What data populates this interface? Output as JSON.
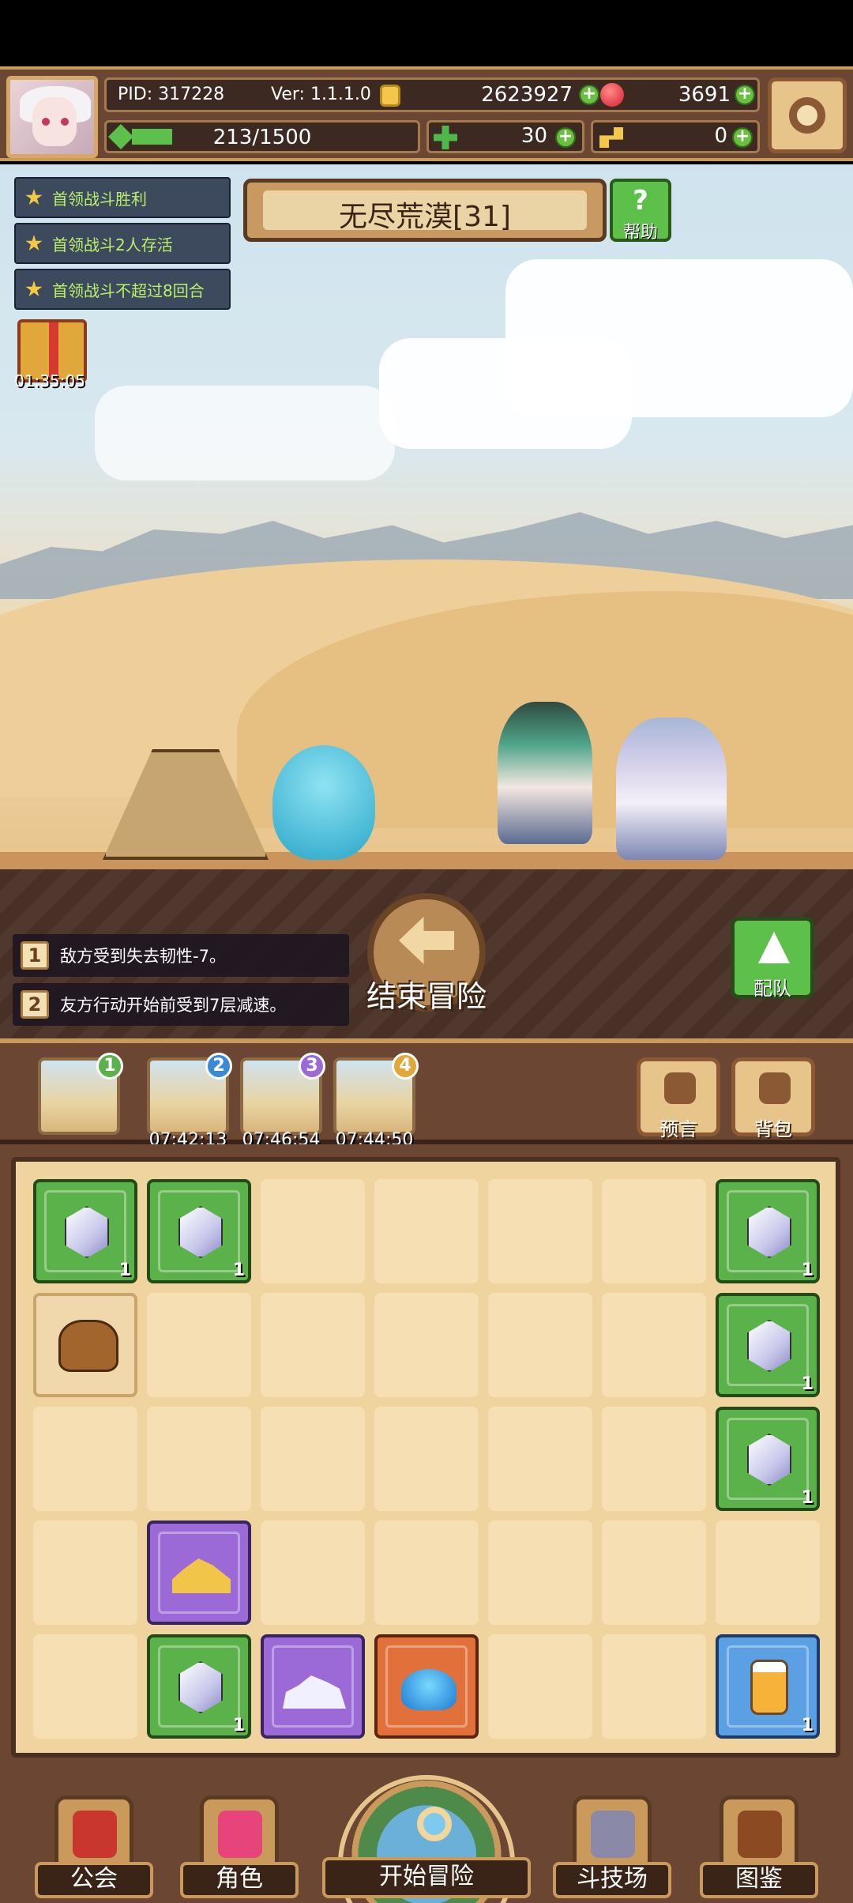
{
  "header": {
    "pid": "PID: 317228",
    "version": "Ver: 1.1.1.0",
    "gold": "2623927",
    "gems": "3691",
    "exp": "213/1500",
    "exp_fraction": 0.142,
    "clover": "30",
    "keys": "0"
  },
  "quests": [
    "首领战斗胜利",
    "首领战斗2人存活",
    "首领战斗不超过8回合"
  ],
  "gift_timer": "01:35:05",
  "stage": {
    "title": "无尽荒漠[31]",
    "help_label": "帮助",
    "help_symbol": "?"
  },
  "effects": [
    {
      "num": "1",
      "text": "敌方受到失去韧性-7。"
    },
    {
      "num": "2",
      "text": "友方行动开始前受到7层减速。"
    }
  ],
  "end_adventure_label": "结束冒险",
  "team_label": "配队",
  "slots": [
    {
      "num": "1",
      "timer": "",
      "color": "#5cb24a"
    },
    {
      "num": "2",
      "timer": "07:42:13",
      "color": "#3a8ad8"
    },
    {
      "num": "3",
      "timer": "07:46:54",
      "color": "#9b6ad6"
    },
    {
      "num": "4",
      "timer": "07:44:50",
      "color": "#e2a73b"
    }
  ],
  "prophecy_label": "预言",
  "backpack_label": "背包",
  "inventory": [
    {
      "item": "white-crystal",
      "qty": "1"
    },
    {
      "item": "white-crystal",
      "qty": "1"
    },
    {
      "item": "white-crystal",
      "qty": "1"
    },
    {
      "item": "cooking-pot",
      "qty": ""
    },
    {
      "item": "white-crystal",
      "qty": "1"
    },
    {
      "item": "white-crystal",
      "qty": "1"
    },
    {
      "item": "gold-pile",
      "qty": ""
    },
    {
      "item": "white-crystal",
      "qty": "1"
    },
    {
      "item": "silver-pile",
      "qty": ""
    },
    {
      "item": "blue-slime",
      "qty": ""
    },
    {
      "item": "potion-jar",
      "qty": "1"
    }
  ],
  "nav": {
    "guild": "公会",
    "character": "角色",
    "start_adventure": "开始冒险",
    "arena": "斗技场",
    "codex": "图鉴"
  }
}
